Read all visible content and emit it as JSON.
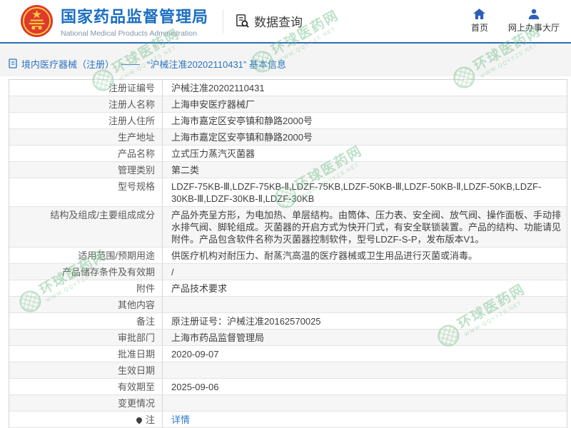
{
  "colors": {
    "accent_blue": "#1b6ec2",
    "header_line_blue": "#2d6bb4",
    "breadcrumb_blue": "#2d74c0",
    "link_blue": "#2d79c8",
    "watermark_green": "#7fc494",
    "emblem_red": "#e0372e",
    "emblem_yellow": "#f3cf3a",
    "row_stripe": "#f6f6f6"
  },
  "header": {
    "org_name_cn": "国家药品监督管理局",
    "org_name_en": "National Medical Products Administration",
    "query_label": "数据查询",
    "nav_home": "首页",
    "nav_hall": "网上办事大厅"
  },
  "breadcrumb": {
    "category": "境内医疗器械（注册）",
    "separator": "——",
    "current": "“沪械注准20202110431” 基本信息"
  },
  "table": {
    "rows": [
      {
        "label": "注册证编号",
        "value": "沪械注准20202110431"
      },
      {
        "label": "注册人名称",
        "value": "上海申安医疗器械厂"
      },
      {
        "label": "注册人住所",
        "value": "上海市嘉定区安亭镇和静路2000号"
      },
      {
        "label": "生产地址",
        "value": "上海市嘉定区安亭镇和静路2000号"
      },
      {
        "label": "产品名称",
        "value": "立式压力蒸汽灭菌器"
      },
      {
        "label": "管理类别",
        "value": "第二类"
      },
      {
        "label": "型号规格",
        "value": "LDZF-75KB-Ⅲ,LDZF-75KB-Ⅱ,LDZF-75KB,LDZF-50KB-Ⅲ,LDZF-50KB-Ⅱ,LDZF-50KB,LDZF-30KB-Ⅲ,LDZF-30KB-Ⅱ,LDZF-30KB"
      },
      {
        "label": "结构及组成/主要组成成分",
        "value": "产品外壳呈方形，为电加热、单层结构。由筒体、压力表、安全阀、放气阀、操作面板、手动排水排气阀、脚轮组成。灭菌器的开启方式为快开门式，有安全联锁装置。产品的结构、功能请见附件。产品包含软件名称为灭菌器控制软件，型号LDZF-S-P，发布版本V1。"
      },
      {
        "label": "适用范围/预期用途",
        "value": "供医疗机构对耐压力、耐蒸汽高温的医疗器械或卫生用品进行灭菌或消毒。"
      },
      {
        "label": "产品储存条件及有效期",
        "value": "/"
      },
      {
        "label": "附件",
        "value": "产品技术要求"
      },
      {
        "label": "其他内容",
        "value": ""
      },
      {
        "label": "备注",
        "value": "原注册证号：沪械注准20162570025"
      },
      {
        "label": "审批部门",
        "value": "上海市药品监督管理局"
      },
      {
        "label": "批准日期",
        "value": "2020-09-07"
      },
      {
        "label": "生效日期",
        "value": ""
      },
      {
        "label": "有效期至",
        "value": "2025-09-06"
      },
      {
        "label": "变更情况",
        "value": ""
      },
      {
        "label": "注",
        "label_icon": "pin-icon",
        "value": "详情",
        "link": true
      }
    ]
  },
  "watermark": {
    "text": "环球医药网",
    "subtext": "WWW.QQYYZS.NET"
  }
}
